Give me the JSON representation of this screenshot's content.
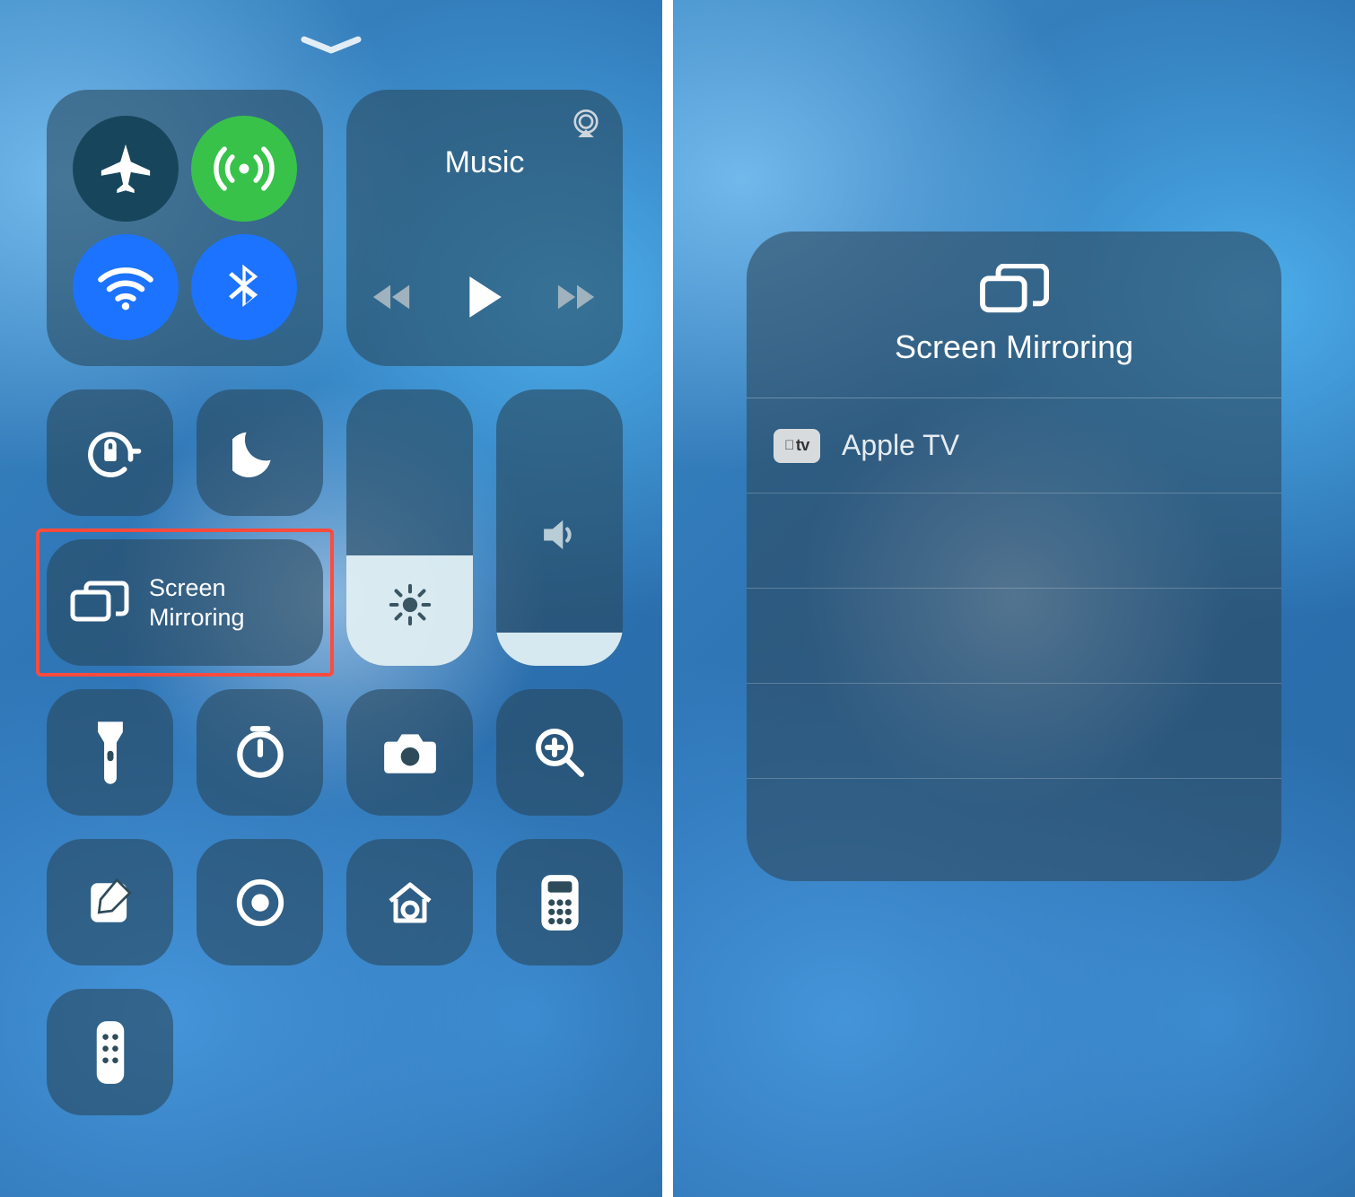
{
  "left": {
    "connectivity": {
      "airplane": {
        "name": "airplane-mode",
        "active": false
      },
      "cellular": {
        "name": "cellular-data",
        "active": true
      },
      "wifi": {
        "name": "wifi",
        "active": true
      },
      "bluetooth": {
        "name": "bluetooth",
        "active": true
      }
    },
    "music": {
      "title": "Music"
    },
    "orientation_lock": {
      "active": false
    },
    "do_not_disturb": {
      "active": false
    },
    "screen_mirroring_tile": {
      "label_line1": "Screen",
      "label_line2": "Mirroring",
      "highlighted": true
    },
    "brightness": {
      "level_percent": 40
    },
    "volume": {
      "level_percent": 12
    },
    "shortcuts": [
      {
        "name": "flashlight"
      },
      {
        "name": "timer"
      },
      {
        "name": "camera"
      },
      {
        "name": "magnifier"
      },
      {
        "name": "notes"
      },
      {
        "name": "screen-record"
      },
      {
        "name": "home"
      },
      {
        "name": "calculator"
      },
      {
        "name": "apple-tv-remote"
      }
    ]
  },
  "right": {
    "panel_title": "Screen Mirroring",
    "devices": [
      {
        "label": "Apple TV",
        "badge": "tv"
      }
    ]
  },
  "colors": {
    "highlight": "#ff4a3d",
    "toggle_green": "#38c24a",
    "toggle_blue": "#1c73ff",
    "toggle_teal": "#17465c"
  }
}
